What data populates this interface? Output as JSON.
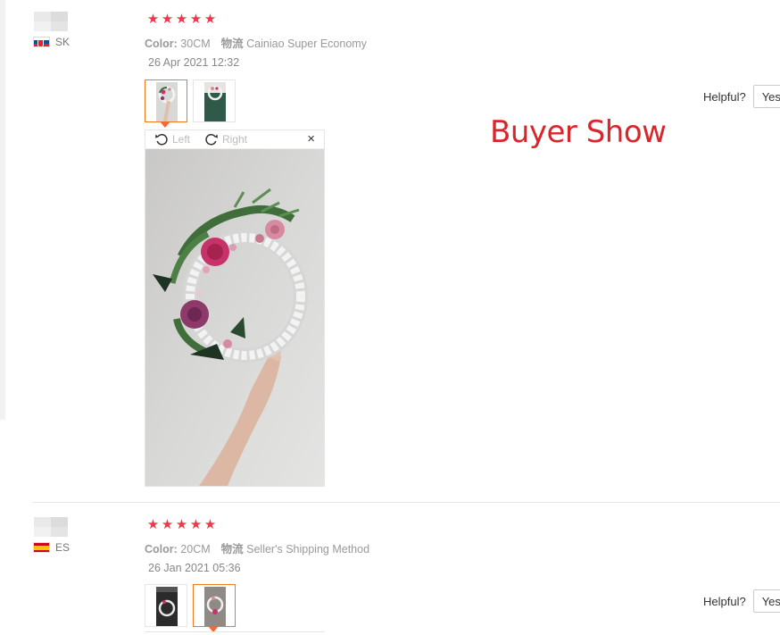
{
  "reviews": [
    {
      "country": "SK",
      "rating": 5,
      "color_label": "Color:",
      "color_value": "30CM",
      "logistics_label": "物流",
      "logistics_value": "Cainiao Super Economy",
      "date": "26 Apr 2021 12:32",
      "thumbnails": 2,
      "active_thumbnail": 1
    },
    {
      "country": "ES",
      "rating": 5,
      "color_label": "Color:",
      "color_value": "20CM",
      "logistics_label": "物流",
      "logistics_value": "Seller's Shipping Method",
      "date": "26 Jan 2021 05:36",
      "thumbnails": 2,
      "active_thumbnail": 2
    }
  ],
  "viewer": {
    "rotate_left": "Left",
    "rotate_right": "Right",
    "close": "×"
  },
  "helpful": {
    "label": "Helpful?",
    "yes": "Yes"
  },
  "annotation": "Buyer Show",
  "star_glyph": "★",
  "colors": {
    "star": "#f2374a",
    "accent": "#f27a1a",
    "annotation": "#d9262b"
  }
}
